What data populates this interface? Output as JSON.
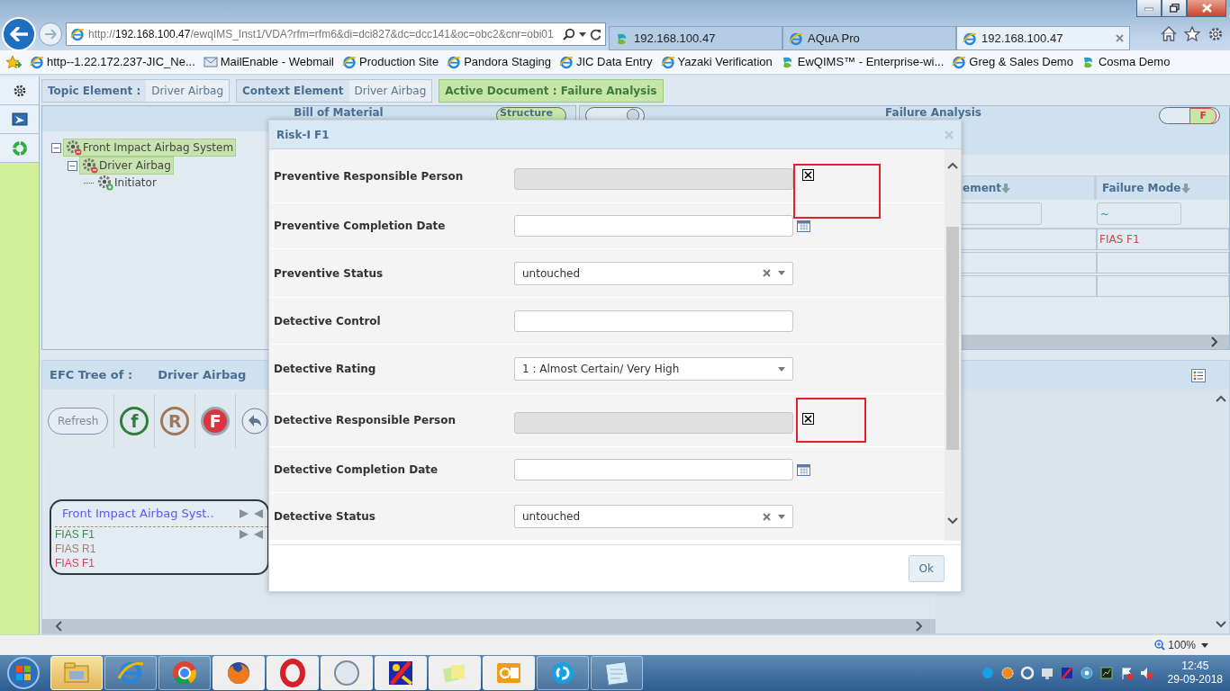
{
  "browser": {
    "address": {
      "scheme": "http://",
      "host": "192.168.100.47",
      "path": "/ewqIMS_Inst1/VDA?rfm=rfm6&di=dci827&dc=dcc141&oc=obc2&cnr=obi01"
    },
    "tabs": [
      {
        "title": "192.168.100.47",
        "kind": "swirl",
        "selected": false
      },
      {
        "title": "AQuA Pro",
        "kind": "ie",
        "selected": false
      },
      {
        "title": "192.168.100.47",
        "kind": "ie",
        "selected": true
      }
    ],
    "favorites": [
      {
        "label": "http--1.22.172.237-JIC_Ne...",
        "kind": "ie"
      },
      {
        "label": "MailEnable - Webmail",
        "kind": "mail"
      },
      {
        "label": "Production Site",
        "kind": "ie"
      },
      {
        "label": "Pandora Staging",
        "kind": "ie"
      },
      {
        "label": "JIC Data Entry",
        "kind": "ie"
      },
      {
        "label": "Yazaki Verification",
        "kind": "ie"
      },
      {
        "label": "EwQIMS™ - Enterprise-wi...",
        "kind": "swirl"
      },
      {
        "label": "Greg & Sales Demo",
        "kind": "ie"
      },
      {
        "label": "Cosma Demo",
        "kind": "swirl"
      }
    ]
  },
  "context": {
    "topic_label": "Topic Element :",
    "topic_value": "Driver Airbag",
    "context_label": "Context Element",
    "context_value": "Driver Airbag",
    "active_document": "Active Document : Failure Analysis"
  },
  "bom": {
    "title": "Bill of Material",
    "toggle": "Structure",
    "tree": [
      {
        "label": "Front Impact Airbag System",
        "highlighted": true,
        "expanded": true,
        "children": [
          {
            "label": "Driver Airbag",
            "highlighted": true,
            "expanded": true,
            "children": [
              {
                "label": "Initiator",
                "highlighted": false
              }
            ]
          }
        ]
      }
    ]
  },
  "failure_analysis": {
    "title": "Failure Analysis",
    "toggle": "F",
    "columns": [
      "ement",
      "Failure Mode"
    ],
    "filter": "~",
    "rows": [
      {
        "failure_mode": "FIAS F1"
      }
    ]
  },
  "efc": {
    "label": "EFC Tree of :",
    "element": "Driver Airbag",
    "refresh": "Refresh",
    "legend": [
      {
        "letter": "f",
        "color": "#2f7d3a",
        "filled": false
      },
      {
        "letter": "R",
        "color": "#a0785a",
        "filled": false
      },
      {
        "letter": "F",
        "color": "#d9343f",
        "filled": true
      }
    ],
    "node": {
      "title": "Front Impact Airbag Syst..",
      "items": [
        {
          "text": "FIAS F1",
          "color": "#3c8a4a"
        },
        {
          "text": "FIAS R1",
          "color": "#a08070"
        },
        {
          "text": "FIAS F1",
          "color": "#e0405a"
        }
      ]
    }
  },
  "dialog": {
    "title": "Risk-I F1",
    "ok": "Ok",
    "rows": [
      {
        "label": "Preventive Responsible Person",
        "kind": "person",
        "disabled": true,
        "highlighted": true
      },
      {
        "label": "Preventive Completion Date",
        "kind": "date"
      },
      {
        "label": "Preventive Status",
        "kind": "select",
        "value": "untouched",
        "clearable": true
      },
      {
        "label": "Detective Control",
        "kind": "text"
      },
      {
        "label": "Detective Rating",
        "kind": "select",
        "value": "1 : Almost Certain/ Very High",
        "clearable": false
      },
      {
        "label": "Detective Responsible Person",
        "kind": "person",
        "disabled": true,
        "highlighted": true
      },
      {
        "label": "Detective Completion Date",
        "kind": "date"
      },
      {
        "label": "Detective Status",
        "kind": "select",
        "value": "untouched",
        "clearable": true
      }
    ]
  },
  "status_bar": {
    "zoom": "100%"
  },
  "taskbar": {
    "apps": [
      {
        "kind": "explorer",
        "running": true,
        "active": true
      },
      {
        "kind": "ie",
        "running": true,
        "active": false
      },
      {
        "kind": "chrome",
        "running": true,
        "active": false
      },
      {
        "kind": "firefox",
        "running": false,
        "active": false
      },
      {
        "kind": "opera",
        "running": false,
        "active": false
      },
      {
        "kind": "compass",
        "running": false,
        "active": false
      },
      {
        "kind": "paint",
        "running": false,
        "active": false
      },
      {
        "kind": "notes",
        "running": false,
        "active": false
      },
      {
        "kind": "outlook",
        "running": false,
        "active": false
      },
      {
        "kind": "chat",
        "running": true,
        "active": false
      },
      {
        "kind": "notepad",
        "running": true,
        "active": false
      }
    ],
    "time": "12:45",
    "date": "29-09-2018"
  }
}
